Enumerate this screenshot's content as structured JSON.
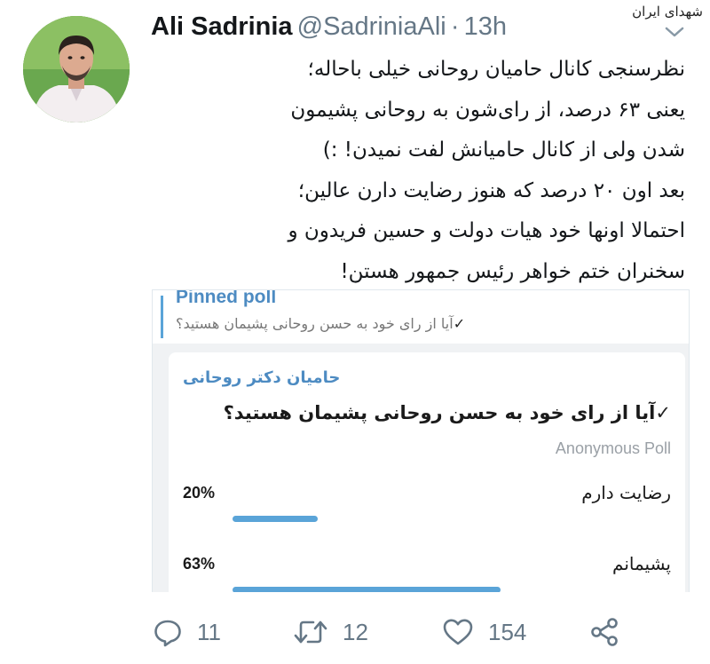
{
  "watermark": "شهدای ایران",
  "tweet": {
    "author_name": "Ali Sadrinia",
    "author_handle": "@SadriniaAli",
    "separator": "·",
    "time": "13h",
    "lines": [
      "نظرسنجی کانال حامیان روحانی خیلی باحاله؛",
      "یعنی ۶۳ درصد، از رای‌شون به روحانی پشیمون",
      "شدن ولی از کانال حامیانش لفت نمیدن! :)",
      "بعد اون ۲۰ درصد که هنوز رضایت دارن عالین؛",
      "احتمالا اونها خود هیات دولت و حسین فریدون و",
      "سخنران ختم خواهر رئیس جمهور هستن!"
    ]
  },
  "media": {
    "pinned_title": "Pinned poll",
    "pinned_question": "آیا از رای خود به حسن روحانی پشیمان هستید؟",
    "channel_name": "حامیان دکتر روحانی",
    "question": "آیا از رای خود به حسن روحانی پشیمان هستید؟",
    "poll_type": "Anonymous Poll",
    "options": [
      {
        "label": "رضایت دارم",
        "percent_text": "20%",
        "percent": 20
      },
      {
        "label": "پشیمانم",
        "percent_text": "63%",
        "percent": 63
      }
    ],
    "check_glyph": "✓",
    "accent_color": "#5aa4d8"
  },
  "actions": {
    "reply_count": "11",
    "retweet_count": "12",
    "like_count": "154"
  }
}
